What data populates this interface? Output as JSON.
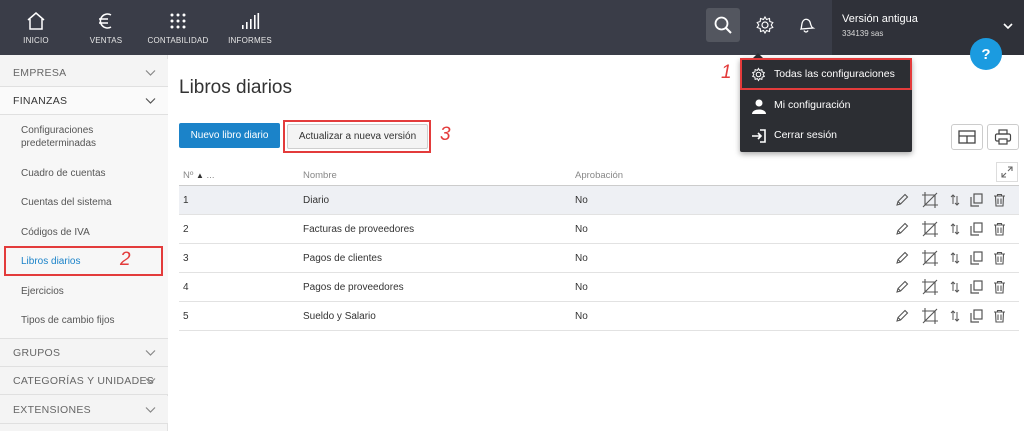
{
  "topnav": {
    "items": [
      {
        "label": "INICIO",
        "icon": "home-icon"
      },
      {
        "label": "VENTAS",
        "icon": "euro-icon"
      },
      {
        "label": "CONTABILIDAD",
        "icon": "grid-icon"
      },
      {
        "label": "INFORMES",
        "icon": "bar-chart-icon"
      }
    ],
    "search_icon": "search-icon",
    "settings_icon": "gear-icon",
    "notifications_icon": "bell-icon",
    "account": {
      "name": "Versión antigua",
      "company": "334139 sas"
    },
    "help_label": "?"
  },
  "dropdown": {
    "items": [
      {
        "label": "Todas las configuraciones",
        "icon": "gear-icon"
      },
      {
        "label": "Mi configuración",
        "icon": "user-icon"
      },
      {
        "label": "Cerrar sesión",
        "icon": "logout-icon"
      }
    ]
  },
  "sidebar": {
    "sections": [
      {
        "label": "EMPRESA"
      },
      {
        "label": "FINANZAS"
      },
      {
        "label": "GRUPOS"
      },
      {
        "label": "CATEGORÍAS Y UNIDADES"
      },
      {
        "label": "EXTENSIONES"
      }
    ],
    "finanzas_items": [
      {
        "label": "Configuraciones predeterminadas"
      },
      {
        "label": "Cuadro de cuentas"
      },
      {
        "label": "Cuentas del sistema"
      },
      {
        "label": "Códigos de IVA"
      },
      {
        "label": "Libros diarios"
      },
      {
        "label": "Ejercicios"
      },
      {
        "label": "Tipos de cambio fijos"
      }
    ]
  },
  "main": {
    "title": "Libros diarios",
    "new_button": "Nuevo libro diario",
    "upgrade_button": "Actualizar a nueva versión",
    "columns": {
      "num": "Nº",
      "num_extra": "...",
      "name": "Nombre",
      "approval": "Aprobación"
    },
    "rows": [
      {
        "num": "1",
        "name": "Diario",
        "approval": "No"
      },
      {
        "num": "2",
        "name": "Facturas de proveedores",
        "approval": "No"
      },
      {
        "num": "3",
        "name": "Pagos de clientes",
        "approval": "No"
      },
      {
        "num": "4",
        "name": "Pagos de proveedores",
        "approval": "No"
      },
      {
        "num": "5",
        "name": "Sueldo y Salario",
        "approval": "No"
      }
    ]
  },
  "annotations": {
    "one": "1",
    "two": "2",
    "three": "3"
  },
  "colors": {
    "topbar": "#3a3d48",
    "accent": "#1b83c9",
    "annotation": "#e33b3b",
    "dropdown": "#2c2e33"
  }
}
